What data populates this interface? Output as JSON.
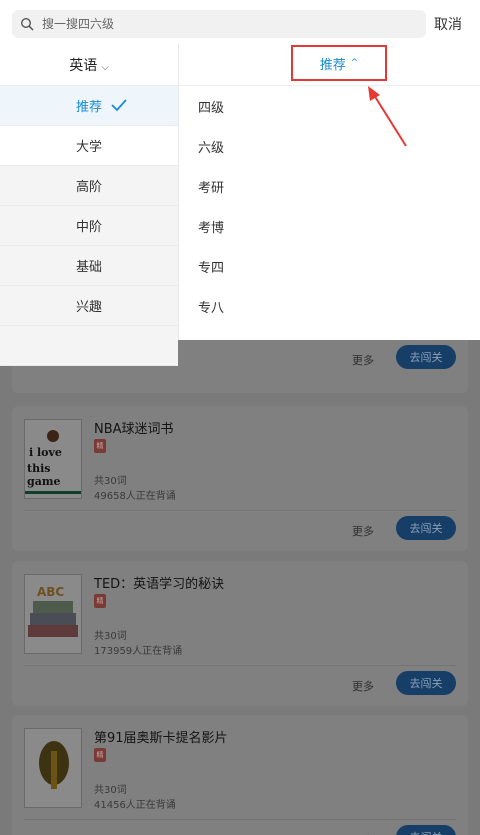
{
  "search": {
    "placeholder": "搜一搜四六级",
    "cancel_label": "取消"
  },
  "filter": {
    "language_label": "英语",
    "sidebar_items": [
      {
        "label": "推荐",
        "state": "selected"
      },
      {
        "label": "大学",
        "state": "active"
      },
      {
        "label": "高阶",
        "state": ""
      },
      {
        "label": "中阶",
        "state": ""
      },
      {
        "label": "基础",
        "state": ""
      },
      {
        "label": "兴趣",
        "state": ""
      },
      {
        "label": "",
        "state": ""
      }
    ],
    "recommend_label": "推荐",
    "right_items": [
      "四级",
      "六级",
      "考研",
      "考博",
      "专四",
      "专八",
      ""
    ]
  },
  "books": {
    "more_label": "更多",
    "go_label": "去闯关",
    "badge_label": "精",
    "items": [
      {
        "title": "NBA球迷词书",
        "word_count": "共30词",
        "learners": "49658人正在背诵",
        "cover_text_1": "i love",
        "cover_text_2": "this game"
      },
      {
        "title": "TED：英语学习的秘诀",
        "word_count": "共30词",
        "learners": "173959人正在背诵",
        "cover_text": "ABC"
      },
      {
        "title": "第91届奥斯卡提名影片",
        "word_count": "共30词",
        "learners": "41456人正在背诵"
      }
    ]
  },
  "colors": {
    "accent": "#1a8ad3",
    "highlight_box": "#e53935",
    "go_button": "#1a6fbf"
  }
}
